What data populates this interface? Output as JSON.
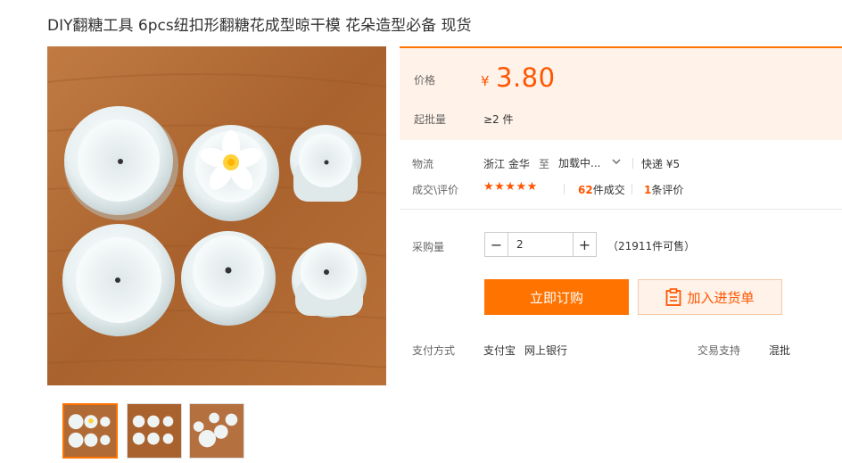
{
  "title": "DIY翻糖工具 6pcs纽扣形翻糖花成型晾干模 花朵造型必备 现货",
  "price": {
    "label": "价格",
    "currency": "¥",
    "value": "3.80"
  },
  "min_order": {
    "label": "起批量",
    "value": "≥2 件"
  },
  "logistics": {
    "label": "物流",
    "origin": "浙江 金华",
    "to": "至",
    "destination": "加载中...",
    "shipping": "快递 ¥5"
  },
  "reviews": {
    "label": "成交\\评价",
    "stars": "★★★★★",
    "rating": 5,
    "deals_count": "62",
    "deals_suffix": "件成交",
    "review_count": "1",
    "review_suffix": "条评价"
  },
  "purchase": {
    "label": "采购量",
    "quantity": "2",
    "minus": "−",
    "plus": "+",
    "stock": "（21911件可售）"
  },
  "actions": {
    "buy_now": "立即订购",
    "add_to_list": "加入进货单"
  },
  "payment": {
    "label": "支付方式",
    "methods": [
      "支付宝",
      "网上银行"
    ]
  },
  "trade_support": {
    "label": "交易支持",
    "value": "混批"
  },
  "colors": {
    "accent": "#ff7300",
    "price": "#ff5500",
    "panel_bg": "#fff2e8"
  },
  "thumbnails": [
    "thumbnail-1",
    "thumbnail-2",
    "thumbnail-3"
  ],
  "icons": [
    "chevron-down-icon",
    "clipboard-icon",
    "star-icon"
  ]
}
